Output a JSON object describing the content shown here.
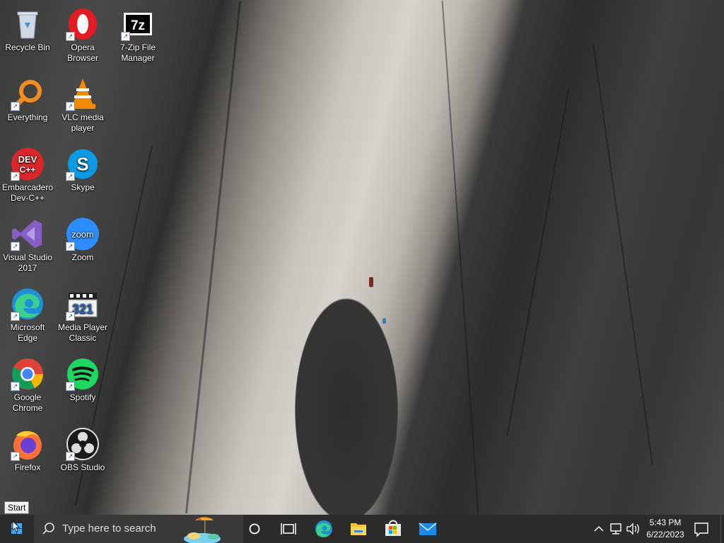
{
  "desktop": {
    "icons": [
      {
        "label": "Recycle Bin",
        "icon": "recycle-bin-icon"
      },
      {
        "label": "Opera Browser",
        "icon": "opera-icon"
      },
      {
        "label": "7-Zip File Manager",
        "icon": "7zip-icon"
      },
      {
        "label": "Everything",
        "icon": "everything-icon"
      },
      {
        "label": "VLC media player",
        "icon": "vlc-icon"
      },
      {
        "label": "Embarcadero Dev-C++",
        "icon": "devcpp-icon"
      },
      {
        "label": "Skype",
        "icon": "skype-icon"
      },
      {
        "label": "Visual Studio 2017",
        "icon": "visual-studio-icon"
      },
      {
        "label": "Zoom",
        "icon": "zoom-icon"
      },
      {
        "label": "Microsoft Edge",
        "icon": "edge-icon"
      },
      {
        "label": "Media Player Classic",
        "icon": "mpc-icon"
      },
      {
        "label": "Google Chrome",
        "icon": "chrome-icon"
      },
      {
        "label": "Spotify",
        "icon": "spotify-icon"
      },
      {
        "label": "Firefox",
        "icon": "firefox-icon"
      },
      {
        "label": "OBS Studio",
        "icon": "obs-icon"
      }
    ],
    "icon_glyphs": {
      "opera": "O",
      "sevenzip": "7z",
      "devcpp_top": "DEV",
      "devcpp_bottom": "C++",
      "skype": "S",
      "zoom": "zoom",
      "mpc": "321"
    },
    "tooltip": "Start"
  },
  "taskbar": {
    "search_placeholder": "Type here to search",
    "pinned": [
      "cortana-icon",
      "task-view-icon",
      "edge-icon",
      "file-explorer-icon",
      "microsoft-store-icon",
      "mail-icon"
    ],
    "clock_time": "5:43 PM",
    "clock_date": "6/22/2023",
    "colors": {
      "taskbar": "#2b2b2b",
      "search": "#3a3a3a",
      "start_blue": "#4aa3f0"
    }
  }
}
